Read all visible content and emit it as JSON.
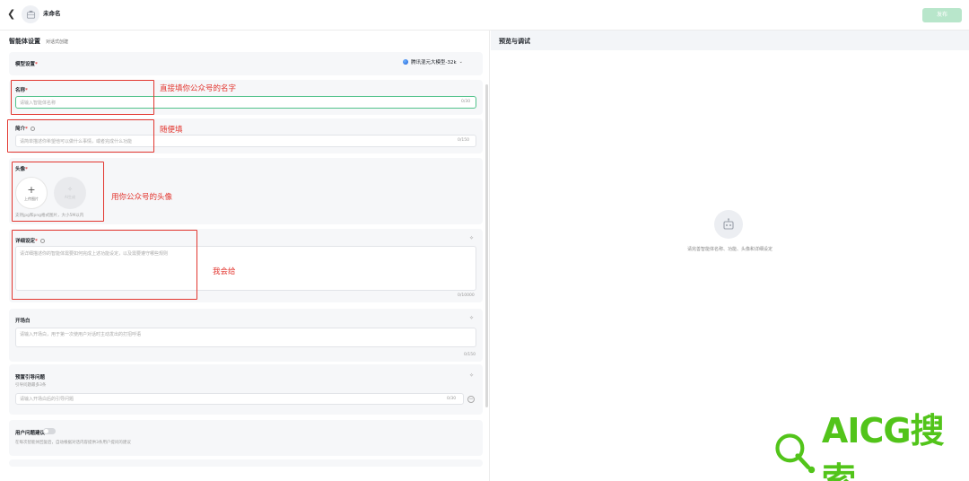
{
  "topbar": {
    "back_icon": "chevron-left-icon",
    "agent_name": "未命名",
    "publish_label": "发布"
  },
  "left": {
    "title": "智能体设置",
    "subtitle": "对话式创建",
    "model": {
      "label": "模型设置",
      "selected": "腾讯混元大模型-32k"
    },
    "name": {
      "label": "名称",
      "placeholder": "请输入智能体名称",
      "counter": "0/30"
    },
    "intro": {
      "label": "简介",
      "placeholder": "请简单描述你希望他可以做什么事情，或者完成什么功能",
      "counter": "0/150"
    },
    "avatar": {
      "label": "头像",
      "upload_label": "上传图片",
      "ai_label": "AI生成",
      "hint": "支持jpg和png格式图片，大小5M以内"
    },
    "detail": {
      "label": "详细设定",
      "placeholder": "请详细描述你的智能体需要如何完成上述功能设定，以及需要遵守哪些规则",
      "counter": "0/10000"
    },
    "opening": {
      "label": "开场白",
      "placeholder": "请输入开场白，用于第一次使用户对话时主动发出的打招呼语",
      "counter": "0/150"
    },
    "preset": {
      "label": "预置引导问题",
      "hint": "引导问题最多3条",
      "placeholder": "请输入开场白后的引导问题",
      "counter": "0/30"
    },
    "suggest": {
      "label": "用户问题建议",
      "hint": "在每次智能体回复后，自动根据对话内容提供3条用户提问的建议"
    }
  },
  "annotations": {
    "name_note": "直接填你公众号的名字",
    "intro_note": "随便填",
    "avatar_note": "用你公众号的头像",
    "detail_note": "我会给"
  },
  "right": {
    "title": "预览与调试",
    "empty_hint": "请完善智能体名称、功能、头像和详细设定"
  },
  "watermark": {
    "text": "AICG搜索"
  },
  "colors": {
    "accent": "#52c28b",
    "annotation": "#e2362f",
    "watermark": "#52c41a"
  }
}
